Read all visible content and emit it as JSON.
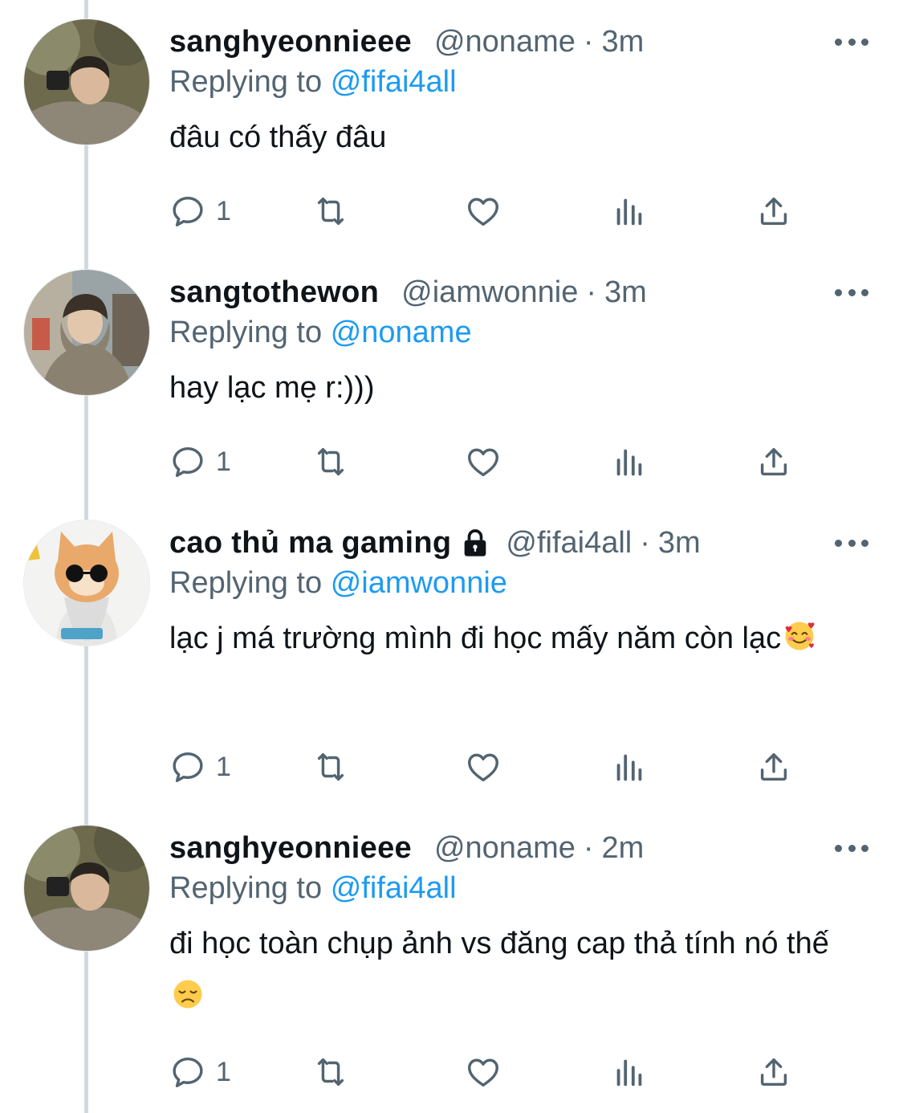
{
  "tweets": [
    {
      "name": "sanghyeonnieee",
      "handle": "@noname",
      "sep": "·",
      "time": "3m",
      "reply_prefix": "Replying to",
      "reply_to": "@fifai4all",
      "text": "đâu có thấy đâu",
      "reply_count": "1",
      "locked": false
    },
    {
      "name": "sangtothewon",
      "handle": "@iamwonnie",
      "sep": "·",
      "time": "3m",
      "reply_prefix": "Replying to",
      "reply_to": "@noname",
      "text": "hay lạc mẹ r:)))",
      "reply_count": "1",
      "locked": false
    },
    {
      "name": "cao thủ ma gaming",
      "handle": "@fifai4all",
      "sep": "·",
      "time": "3m",
      "reply_prefix": "Replying to",
      "reply_to": "@iamwonnie",
      "text": "lạc j má trường mình đi học mấy năm còn lạc",
      "reply_count": "1",
      "locked": true,
      "emoji": "smiling-face-with-hearts"
    },
    {
      "name": "sanghyeonnieee",
      "handle": "@noname",
      "sep": "·",
      "time": "2m",
      "reply_prefix": "Replying to",
      "reply_to": "@fifai4all",
      "text": "đi học toàn chụp ảnh vs đăng cap thả tính nó thế",
      "reply_count": "1",
      "locked": false,
      "emoji": "disappointed-face"
    }
  ],
  "colors": {
    "text": "#0f1419",
    "secondary": "#536471",
    "link": "#1d9bf0",
    "thread_line": "#cfd9de"
  },
  "icons": [
    "reply-icon",
    "retweet-icon",
    "like-icon",
    "views-icon",
    "share-icon",
    "more-icon",
    "lock-icon"
  ]
}
